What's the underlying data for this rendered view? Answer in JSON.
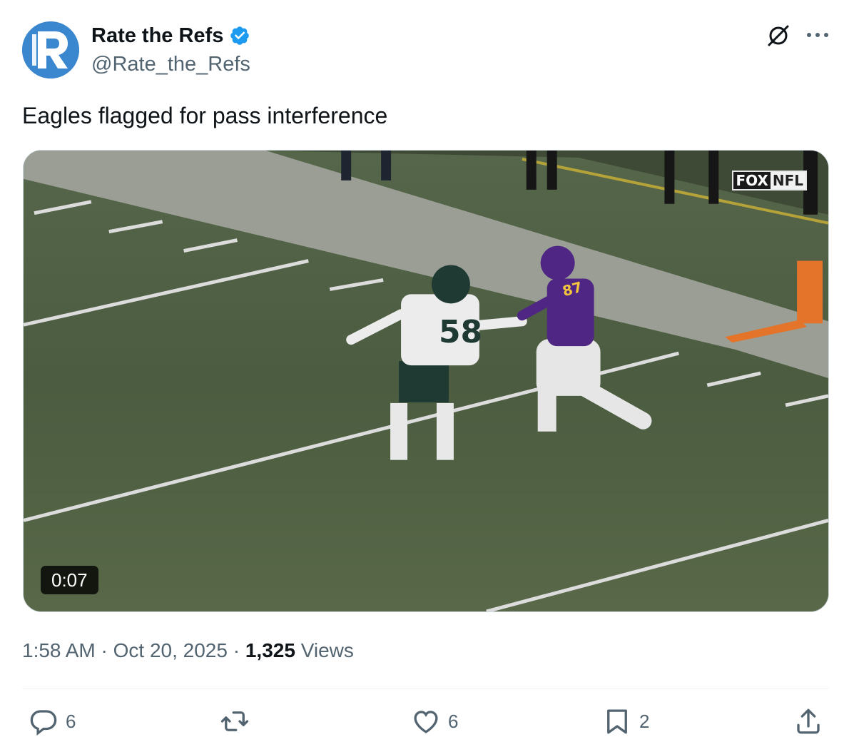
{
  "author": {
    "name": "Rate the Refs",
    "handle": "@Rate_the_Refs",
    "verified": true,
    "avatar_color": "#3a86cf"
  },
  "tweet": {
    "text": "Eagles flagged for pass interference"
  },
  "media": {
    "duration": "0:07",
    "watermark_a": "FOX",
    "watermark_b": "NFL",
    "jersey_left": "58",
    "jersey_right": "87"
  },
  "meta": {
    "time": "1:58 AM",
    "sep1": " · ",
    "date": "Oct 20, 2025",
    "sep2": " · ",
    "views_count": "1,325",
    "views_label": "Views"
  },
  "actions": {
    "replies": "6",
    "reposts": "",
    "likes": "6",
    "bookmarks": "2"
  },
  "colors": {
    "verified": "#1d9bf0",
    "muted": "#536471",
    "text": "#0f1419"
  },
  "icons": [
    "verified-badge-icon",
    "grok-icon",
    "more-icon",
    "reply-icon",
    "repost-icon",
    "like-icon",
    "bookmark-icon",
    "share-icon"
  ]
}
